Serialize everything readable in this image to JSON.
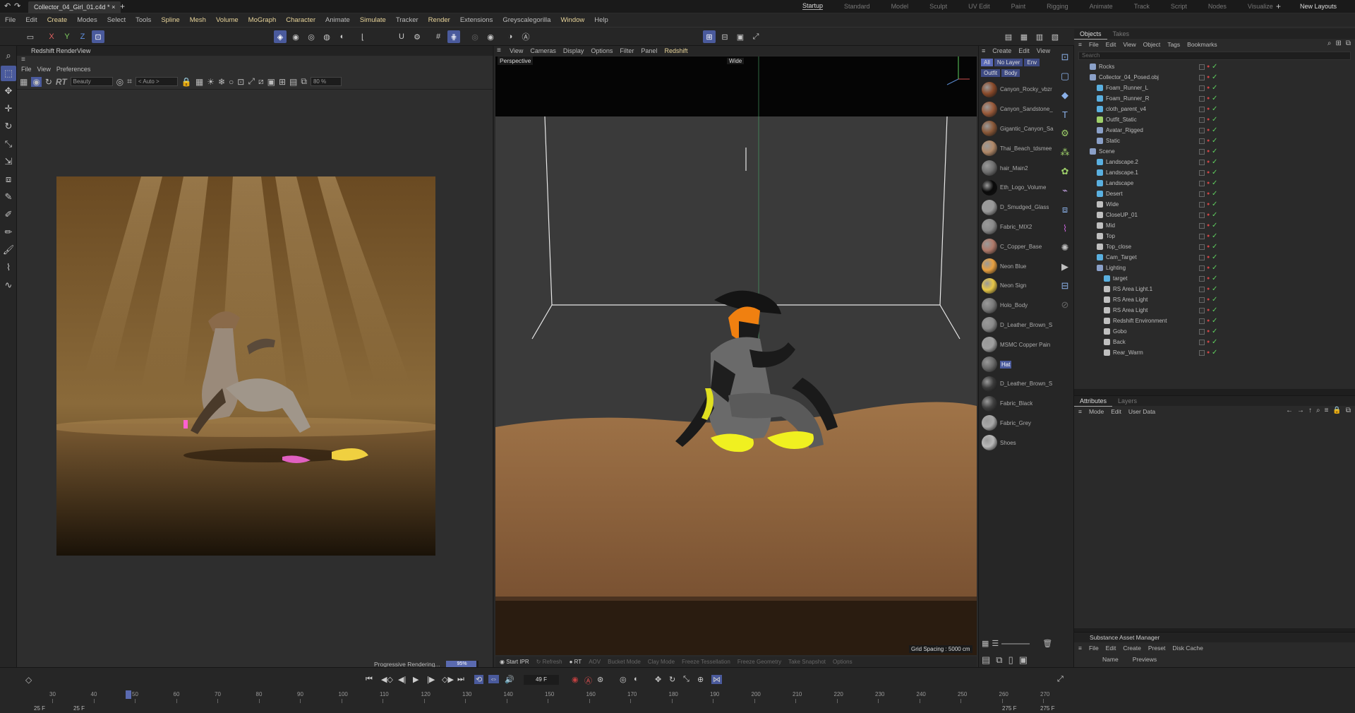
{
  "titlebar": {
    "doc_title": "Collector_04_Girl_01.c4d *",
    "layouts": [
      "Startup",
      "Standard",
      "Model",
      "Sculpt",
      "UV Edit",
      "Paint",
      "Rigging",
      "Animate",
      "Track",
      "Script",
      "Nodes",
      "Visualize"
    ],
    "active_layout": "Startup",
    "new_layouts": "New Layouts"
  },
  "menubar": {
    "items": [
      "File",
      "Edit",
      "Create",
      "Modes",
      "Select",
      "Tools",
      "Spline",
      "Mesh",
      "Volume",
      "MoGraph",
      "Character",
      "Animate",
      "Simulate",
      "Tracker",
      "Render",
      "Extensions",
      "Greyscalegorilla",
      "Window",
      "Help"
    ]
  },
  "toolbar": {
    "axes": [
      "X",
      "Y",
      "Z"
    ]
  },
  "renderview": {
    "title": "Redshift RenderView",
    "menu": [
      "File",
      "View",
      "Preferences"
    ],
    "rt_label": "RT",
    "aov": "Beauty",
    "region": "< Auto >",
    "zoom": "80 %",
    "status": "Progressive Rendering...",
    "progress_text": "95%",
    "progress_value": 0.95
  },
  "viewport": {
    "menu": [
      "View",
      "Cameras",
      "Display",
      "Options",
      "Filter",
      "Panel",
      "Redshift"
    ],
    "label": "Perspective",
    "camera": "Wide",
    "grid_spacing": "Grid Spacing : 5000 cm",
    "ipr_bar": {
      "start_ipr": "Start IPR",
      "refresh": "Refresh",
      "rt": "RT",
      "aov": "AOV",
      "bucket": "Bucket Mode",
      "clay": "Clay Mode",
      "freeze_tess": "Freeze Tessellation",
      "freeze_geo": "Freeze Geometry",
      "snapshot": "Take Snapshot",
      "options": "Options"
    }
  },
  "materials": {
    "menu": [
      "Create",
      "Edit",
      "View"
    ],
    "filters": [
      "All",
      "No Layer",
      "Env",
      "Outfit",
      "Body"
    ],
    "items": [
      {
        "name": "Canyon_Rocky_vbzr",
        "color": "#8a4a2a"
      },
      {
        "name": "Canyon_Sandstone_",
        "color": "#9a5a3a"
      },
      {
        "name": "Gigantic_Canyon_Sa",
        "color": "#8a5838"
      },
      {
        "name": "Thai_Beach_tdsmee",
        "color": "#b08868"
      },
      {
        "name": "hair_Main2",
        "color": "#707070"
      },
      {
        "name": "Eth_Logo_Volume",
        "color": "#0a0a0a"
      },
      {
        "name": "D_Smudged_Glass",
        "color": "#9a9a9a"
      },
      {
        "name": "Fabric_MIX2",
        "color": "#8a8a8a"
      },
      {
        "name": "C_Copper_Base",
        "color": "#b07a6a"
      },
      {
        "name": "Neon Blue",
        "color": "#e8a040"
      },
      {
        "name": "Neon Sign",
        "color": "#e8c848"
      },
      {
        "name": "Holo_Body",
        "color": "#7a7a7a"
      },
      {
        "name": "D_Leather_Brown_S",
        "color": "#8a8a8a"
      },
      {
        "name": "MSMC Copper Pain",
        "color": "#a0a0a0"
      },
      {
        "name": "Hat",
        "color": "#6a6a6a"
      },
      {
        "name": "D_Leather_Brown_S",
        "color": "#3a3a3a"
      },
      {
        "name": "Fabric_Black",
        "color": "#404040"
      },
      {
        "name": "Fabric_Grey",
        "color": "#a8a8a8"
      },
      {
        "name": "Shoes",
        "color": "#b8b8b8"
      }
    ],
    "selected_index": 14
  },
  "objects": {
    "tabs": [
      "Objects",
      "Takes"
    ],
    "menu": [
      "File",
      "Edit",
      "View",
      "Object",
      "Tags",
      "Bookmarks"
    ],
    "search_placeholder": "Search",
    "rows": [
      {
        "name": "Rocks",
        "indent": 0,
        "color": "#8aa0c8"
      },
      {
        "name": "Collector_04_Posed.obj",
        "indent": 0,
        "color": "#8aa0c8"
      },
      {
        "name": "Foam_Runner_L",
        "indent": 1,
        "color": "#5ab0e0"
      },
      {
        "name": "Foam_Runner_R",
        "indent": 1,
        "color": "#5ab0e0"
      },
      {
        "name": "cloth_parent_v4",
        "indent": 1,
        "color": "#5ab0e0"
      },
      {
        "name": "Outfit_Static",
        "indent": 1,
        "color": "#9ed06a"
      },
      {
        "name": "Avatar_Rigged",
        "indent": 1,
        "color": "#8aa0c8"
      },
      {
        "name": "Static",
        "indent": 1,
        "color": "#8aa0c8"
      },
      {
        "name": "Scene",
        "indent": 0,
        "color": "#8aa0c8"
      },
      {
        "name": "Landscape.2",
        "indent": 1,
        "color": "#5ab0e0"
      },
      {
        "name": "Landscape.1",
        "indent": 1,
        "color": "#5ab0e0"
      },
      {
        "name": "Landscape",
        "indent": 1,
        "color": "#5ab0e0"
      },
      {
        "name": "Desert",
        "indent": 1,
        "color": "#5ab0e0"
      },
      {
        "name": "Wide",
        "indent": 1,
        "color": "#c0c0c0"
      },
      {
        "name": "CloseUP_01",
        "indent": 1,
        "color": "#c0c0c0"
      },
      {
        "name": "Mid",
        "indent": 1,
        "color": "#c0c0c0"
      },
      {
        "name": "Top",
        "indent": 1,
        "color": "#c0c0c0"
      },
      {
        "name": "Top_close",
        "indent": 1,
        "color": "#c0c0c0"
      },
      {
        "name": "Cam_Target",
        "indent": 1,
        "color": "#5ab0e0"
      },
      {
        "name": "Lighting",
        "indent": 1,
        "color": "#8aa0c8"
      },
      {
        "name": "target",
        "indent": 2,
        "color": "#5ab0e0"
      },
      {
        "name": "RS Area Light.1",
        "indent": 2,
        "color": "#c0c0c0"
      },
      {
        "name": "RS Area Light",
        "indent": 2,
        "color": "#c0c0c0"
      },
      {
        "name": "RS Area Light",
        "indent": 2,
        "color": "#c0c0c0"
      },
      {
        "name": "Redshift Environment",
        "indent": 2,
        "color": "#c0c0c0"
      },
      {
        "name": "Gobo",
        "indent": 2,
        "color": "#c0c0c0"
      },
      {
        "name": "Back",
        "indent": 2,
        "color": "#c0c0c0"
      },
      {
        "name": "Rear_Warm",
        "indent": 2,
        "color": "#c0c0c0"
      }
    ]
  },
  "attributes": {
    "tabs": [
      "Attributes",
      "Layers"
    ],
    "menu": [
      "Mode",
      "Edit",
      "User Data"
    ]
  },
  "substance": {
    "title": "Substance Asset Manager",
    "menu": [
      "File",
      "Edit",
      "Create",
      "Preset",
      "Disk Cache"
    ],
    "columns": [
      "Name",
      "Previews"
    ]
  },
  "timeline": {
    "current_frame": "49 F",
    "ticks": [
      "30",
      "40",
      "50",
      "60",
      "70",
      "80",
      "90",
      "100",
      "110",
      "120",
      "130",
      "140",
      "150",
      "160",
      "170",
      "180",
      "190",
      "200",
      "210",
      "220",
      "230",
      "240",
      "250",
      "260",
      "270"
    ],
    "start_a": "25 F",
    "start_b": "25 F",
    "end_a": "275 F",
    "end_b": "275 F"
  }
}
